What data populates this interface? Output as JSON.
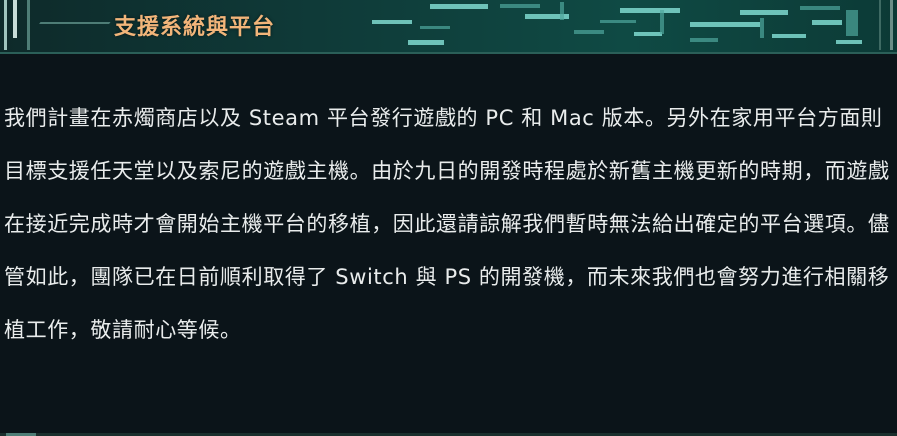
{
  "header": {
    "title": "支援系統與平台"
  },
  "content": {
    "paragraph": "我們計畫在赤燭商店以及 Steam 平台發行遊戲的 PC 和 Mac 版本。另外在家用平台方面則目標支援任天堂以及索尼的遊戲主機。由於九日的開發時程處於新舊主機更新的時期，而遊戲在接近完成時才會開始主機平台的移植，因此還請諒解我們暫時無法給出確定的平台選項。儘管如此，團隊已在日前順利取得了 Switch 與 PS 的開發機，而未來我們也會努力進行相關移植工作，敬請耐心等候。"
  },
  "colors": {
    "title": "#f2b57a",
    "background": "#0b1419",
    "header_accent": "#7fd9cf",
    "text": "#e9ecec"
  }
}
